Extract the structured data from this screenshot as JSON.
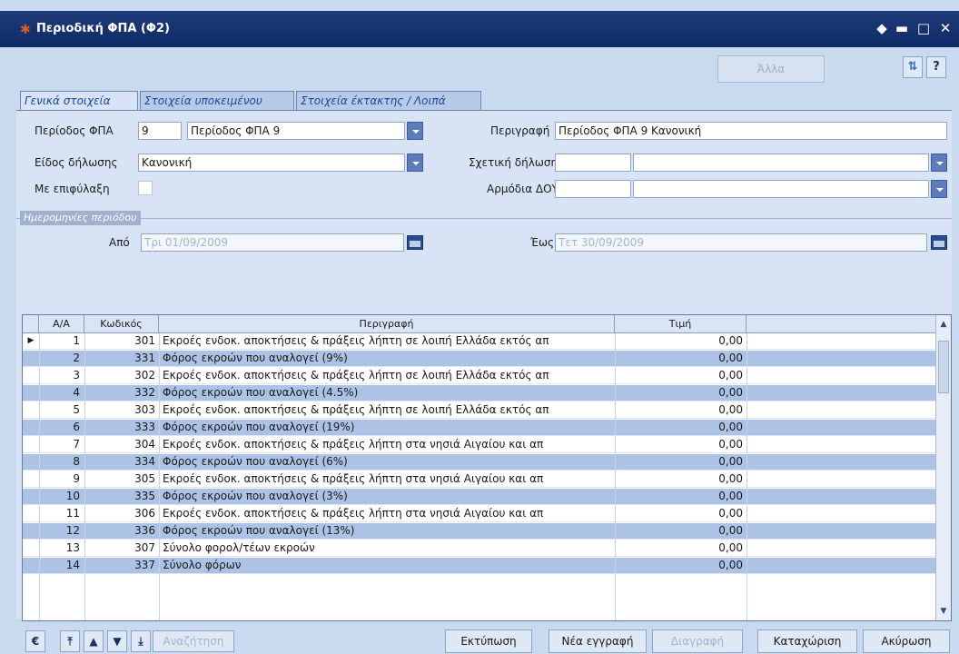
{
  "window": {
    "title": "Περιοδική ΦΠΑ (Φ2)",
    "icon": "app-icon",
    "controls": [
      "pin",
      "minimize",
      "maximize",
      "close"
    ]
  },
  "toolbar": {
    "other_label": "Άλλα",
    "icons": [
      "filter-icon",
      "help-icon"
    ]
  },
  "tabs": [
    {
      "label": "Γενικά στοιχεία",
      "active": true
    },
    {
      "label": "Στοιχεία υποκειμένου",
      "active": false
    },
    {
      "label": "Στοιχεία έκτακτης / Λοιπά",
      "active": false
    }
  ],
  "form": {
    "period_label": "Περίοδος ΦΠΑ",
    "period_code": "9",
    "period_name": "Περίοδος ΦΠΑ 9",
    "declaration_type_label": "Είδος δήλωσης",
    "declaration_type_value": "Κανονική",
    "with_reservation_label": "Με επιφύλαξη",
    "description_label": "Περιγραφή",
    "description_value": "Περίοδος ΦΠΑ 9 Κανονική",
    "related_declaration_label": "Σχετική δήλωση",
    "related_declaration_value": "",
    "tax_office_label": "Αρμόδια ΔΟΥ",
    "tax_office_value": ""
  },
  "period_dates": {
    "section_label": "Ημερομηνίες περιόδου",
    "from_label": "Από",
    "from_value": "Τρι 01/09/2009",
    "to_label": "Έως",
    "to_value": "Τετ 30/09/2009"
  },
  "grid": {
    "columns": [
      "Α/Α",
      "Κωδικός",
      "Περιγραφή",
      "Τιμή"
    ],
    "rows": [
      {
        "aa": "1",
        "code": "301",
        "desc": "Εκροές ενδοκ. αποκτήσεις & πράξεις λήπτη σε λοιπή Ελλάδα εκτός απ",
        "value": "0,00"
      },
      {
        "aa": "2",
        "code": "331",
        "desc": "Φόρος εκροών που αναλογεί (9%)",
        "value": "0,00"
      },
      {
        "aa": "3",
        "code": "302",
        "desc": "Εκροές ενδοκ. αποκτήσεις & πράξεις λήπτη σε λοιπή Ελλάδα εκτός απ",
        "value": "0,00"
      },
      {
        "aa": "4",
        "code": "332",
        "desc": "Φόρος εκροών που αναλογεί (4.5%)",
        "value": "0,00"
      },
      {
        "aa": "5",
        "code": "303",
        "desc": "Εκροές ενδοκ. αποκτήσεις & πράξεις λήπτη σε λοιπή Ελλάδα εκτός απ",
        "value": "0,00"
      },
      {
        "aa": "6",
        "code": "333",
        "desc": "Φόρος εκροών που αναλογεί (19%)",
        "value": "0,00"
      },
      {
        "aa": "7",
        "code": "304",
        "desc": "Εκροές ενδοκ. αποκτήσεις & πράξεις λήπτη στα νησιά Αιγαίου και απ",
        "value": "0,00"
      },
      {
        "aa": "8",
        "code": "334",
        "desc": "Φόρος εκροών που αναλογεί (6%)",
        "value": "0,00"
      },
      {
        "aa": "9",
        "code": "305",
        "desc": "Εκροές ενδοκ. αποκτήσεις & πράξεις λήπτη στα νησιά Αιγαίου και απ",
        "value": "0,00"
      },
      {
        "aa": "10",
        "code": "335",
        "desc": "Φόρος εκροών που αναλογεί (3%)",
        "value": "0,00"
      },
      {
        "aa": "11",
        "code": "306",
        "desc": "Εκροές ενδοκ. αποκτήσεις & πράξεις λήπτη στα νησιά Αιγαίου και απ",
        "value": "0,00"
      },
      {
        "aa": "12",
        "code": "336",
        "desc": "Φόρος εκροών που αναλογεί (13%)",
        "value": "0,00"
      },
      {
        "aa": "13",
        "code": "307",
        "desc": "Σύνολο φορολ/τέων εκροών",
        "value": "0,00"
      },
      {
        "aa": "14",
        "code": "337",
        "desc": "Σύνολο φόρων",
        "value": "0,00"
      }
    ]
  },
  "bottom": {
    "euro_symbol": "€",
    "search_label": "Αναζήτηση",
    "print_label": "Εκτύπωση",
    "new_label": "Νέα εγγραφή",
    "delete_label": "Διαγραφή",
    "save_label": "Καταχώριση",
    "cancel_label": "Ακύρωση"
  },
  "colors": {
    "titlebar": "#14306e",
    "window_bg": "#c9d9ee",
    "panel_bg": "#d8e4f5",
    "row_alt": "#adc3e6",
    "dropdown": "#5c7cbb"
  }
}
